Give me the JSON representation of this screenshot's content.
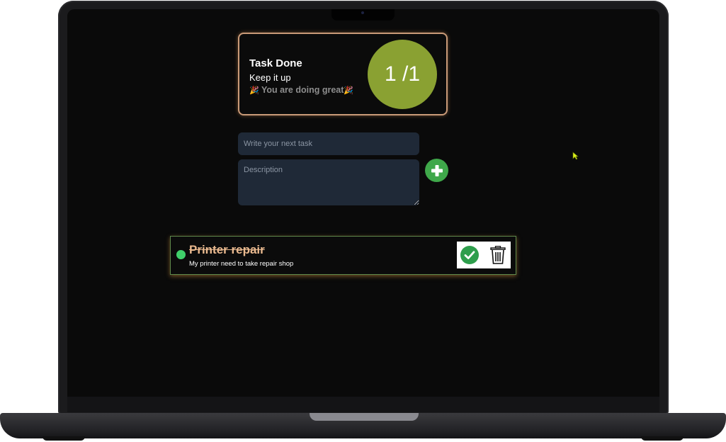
{
  "summary": {
    "title": "Task Done",
    "subtitle": "Keep it up",
    "cheer_emoji_left": "🎉",
    "cheer_text": "You are doing great",
    "cheer_emoji_right": "🎉",
    "progress_text": "1 /1",
    "completed": 1,
    "total": 1
  },
  "form": {
    "task_placeholder": "Write your next task",
    "description_placeholder": "Description",
    "add_icon": "plus-icon"
  },
  "tasks": [
    {
      "title": "Printer repair",
      "description": "My printer need to take repair shop",
      "completed": true,
      "status_icon": "check-circle-icon",
      "delete_icon": "trash-icon"
    }
  ],
  "colors": {
    "progress_circle": "#8aa132",
    "accent_green": "#3fa84a",
    "card_border": "#c99a78",
    "input_bg": "#1f2937",
    "task_title": "#e9b98f"
  }
}
